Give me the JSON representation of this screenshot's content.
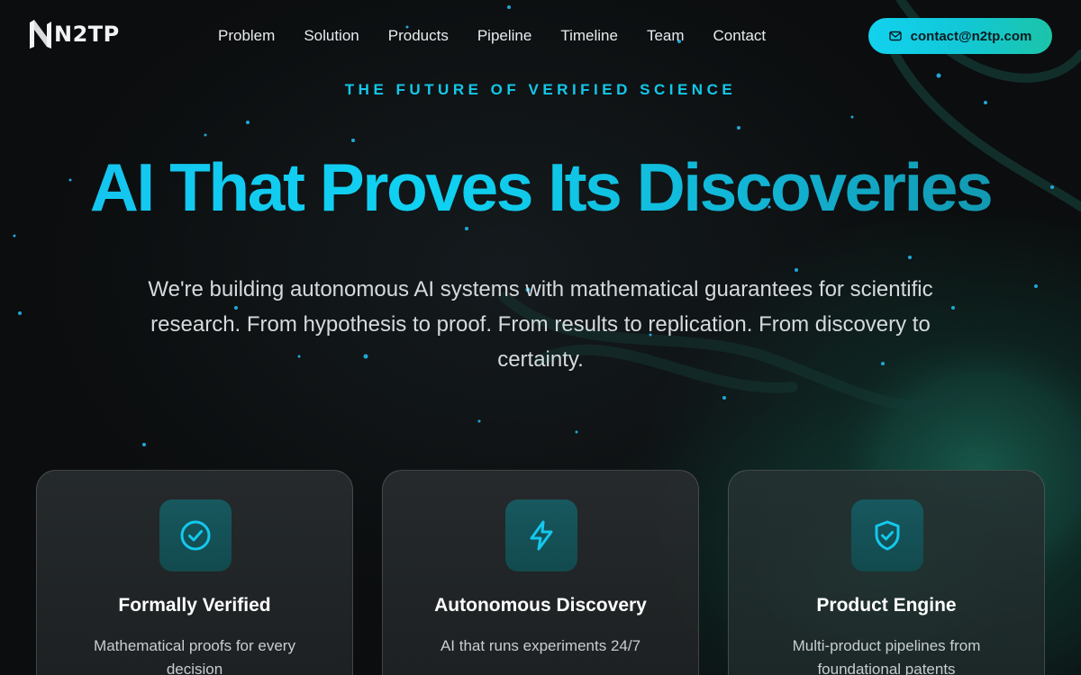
{
  "brand": {
    "name": "N2TP"
  },
  "nav": {
    "links": [
      "Problem",
      "Solution",
      "Products",
      "Pipeline",
      "Timeline",
      "Team",
      "Contact"
    ],
    "contact_button": "contact@n2tp.com",
    "contact_icon": "mail-icon"
  },
  "hero": {
    "eyebrow": "THE FUTURE OF VERIFIED SCIENCE",
    "headline": "AI That Proves Its Discoveries",
    "subtext": "We're building autonomous AI systems with mathematical guarantees for scientific research. From hypothesis to proof. From results to replication. From discovery to certainty."
  },
  "cards": [
    {
      "icon": "check-circle-icon",
      "title": "Formally Verified",
      "desc": "Mathematical proofs for every decision"
    },
    {
      "icon": "lightning-icon",
      "title": "Autonomous Discovery",
      "desc": "AI that runs experiments 24/7"
    },
    {
      "icon": "shield-check-icon",
      "title": "Product Engine",
      "desc": "Multi-product pipelines from foundational patents"
    }
  ],
  "colors": {
    "accent": "#12c8ea",
    "button_gradient_start": "#12d2ee",
    "button_gradient_end": "#1bc4a8",
    "icon_box": "#17585e",
    "background": "#0b0d0e"
  }
}
